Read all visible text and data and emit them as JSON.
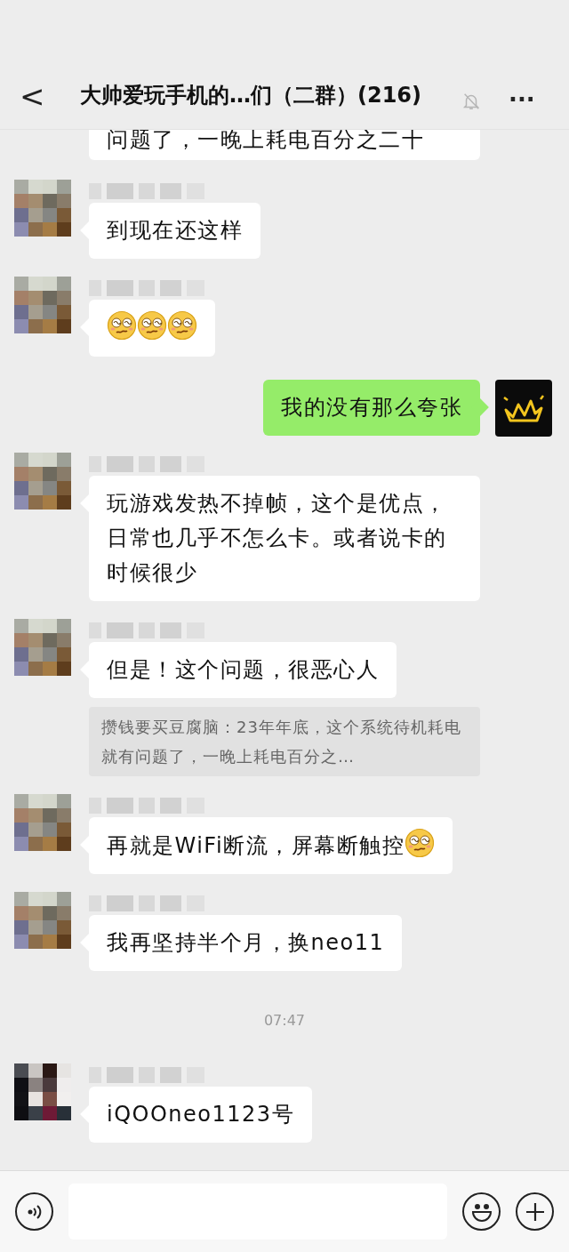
{
  "header": {
    "back": "<",
    "title": "大帅爱玩手机的…们（二群）(216)",
    "muted": true,
    "more": "···"
  },
  "messages": [
    {
      "kind": "partial",
      "text": "问题了，一晚上耗电百分之二十"
    },
    {
      "kind": "incoming",
      "parts": [
        {
          "kind": "text",
          "text": "到现在还这样"
        }
      ]
    },
    {
      "kind": "incoming",
      "parts": [
        {
          "kind": "emoji"
        },
        {
          "kind": "emoji"
        },
        {
          "kind": "emoji"
        }
      ]
    },
    {
      "kind": "outgoing",
      "parts": [
        {
          "kind": "text",
          "text": "我的没有那么夸张"
        }
      ]
    },
    {
      "kind": "incoming",
      "parts": [
        {
          "kind": "text",
          "text": "玩游戏发热不掉帧，这个是优点，日常也几乎不怎么卡。或者说卡的时候很少"
        }
      ]
    },
    {
      "kind": "incoming",
      "parts": [
        {
          "kind": "text",
          "text": "但是！这个问题，很恶心人"
        }
      ],
      "quote": "攒钱要买豆腐脑：23年年底，这个系统待机耗电就有问题了，一晚上耗电百分之…"
    },
    {
      "kind": "incoming",
      "parts": [
        {
          "kind": "text",
          "text": "再就是WiFi断流，屏幕断触控"
        },
        {
          "kind": "emoji"
        }
      ]
    },
    {
      "kind": "incoming",
      "parts": [
        {
          "kind": "text",
          "text": "我再坚持半个月，换neo11"
        }
      ]
    },
    {
      "kind": "time",
      "text": "07:47"
    },
    {
      "kind": "incoming",
      "dark": true,
      "parts": [
        {
          "kind": "text",
          "text": "iQOOneo1123号"
        }
      ]
    }
  ]
}
